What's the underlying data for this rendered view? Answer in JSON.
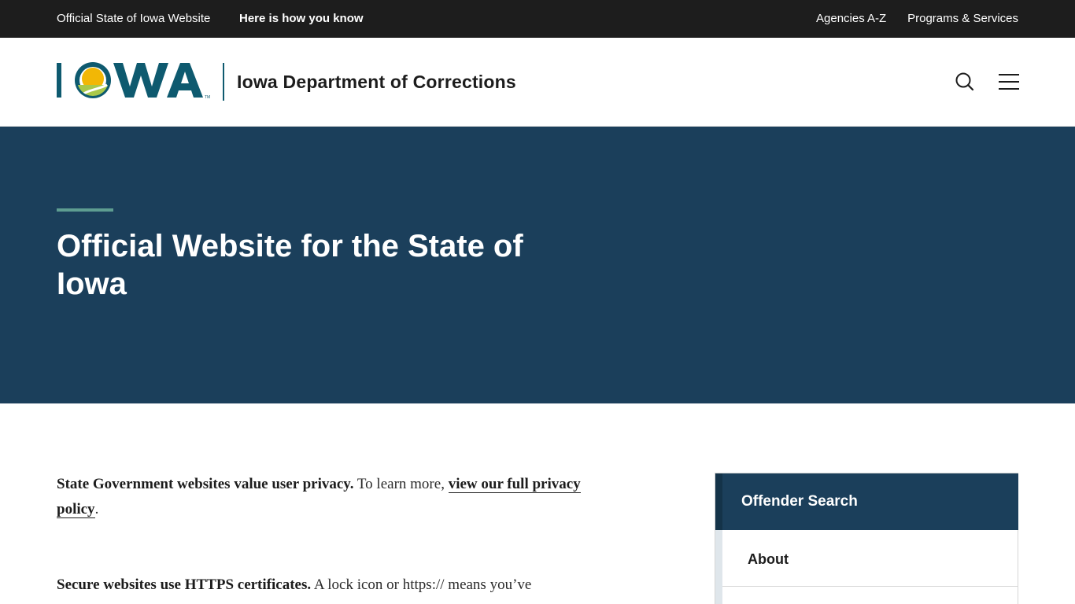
{
  "topbar": {
    "official": "Official State of Iowa Website",
    "how_you_know": "Here is how you know",
    "agencies": "Agencies A-Z",
    "programs": "Programs & Services"
  },
  "header": {
    "logo_text": "IOWA",
    "department": "Iowa Department of Corrections",
    "search_icon": "search-icon",
    "menu_icon": "hamburger-menu-icon"
  },
  "hero": {
    "title": "Official Website for the State of Iowa"
  },
  "content": {
    "privacy_bold": "State Government websites value user privacy.",
    "privacy_text": " To learn more, ",
    "privacy_link": "view our full privacy policy",
    "privacy_end": ".",
    "https_bold": "Secure websites use HTTPS certificates.",
    "https_text": " A lock icon or https:// means you’ve"
  },
  "sidebar": {
    "heading": "Offender Search",
    "items": [
      {
        "label": "About"
      }
    ]
  },
  "colors": {
    "topbar": "#1d1d1d",
    "hero": "#1b3f5b",
    "accent": "#5e9d91",
    "logo_teal": "#0e5a6f"
  }
}
